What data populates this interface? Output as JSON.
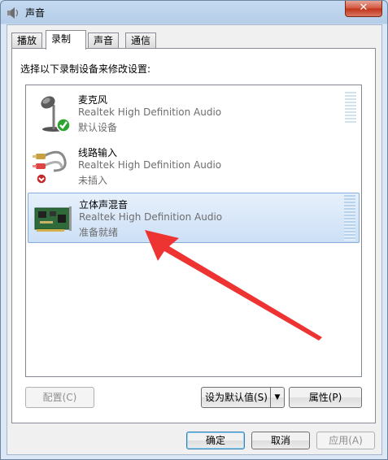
{
  "window": {
    "title": "声音",
    "close_symbol": "✕"
  },
  "tabs": [
    {
      "label": "播放"
    },
    {
      "label": "录制"
    },
    {
      "label": "声音"
    },
    {
      "label": "通信"
    }
  ],
  "instruction": "选择以下录制设备来修改设置:",
  "devices": [
    {
      "name": "麦克风",
      "driver": "Realtek High Definition Audio",
      "status": "默认设备",
      "icon": "microphone-icon"
    },
    {
      "name": "线路输入",
      "driver": "Realtek High Definition Audio",
      "status": "未插入",
      "icon": "line-in-icon"
    },
    {
      "name": "立体声混音",
      "driver": "Realtek High Definition Audio",
      "status": "准备就绪",
      "icon": "sound-card-icon"
    }
  ],
  "buttons": {
    "configure": "配置(C)",
    "set_default": "设为默认值(S)",
    "properties": "属性(P)",
    "ok": "确定",
    "cancel": "取消",
    "apply": "应用(A)"
  },
  "colors": {
    "accent": "#3399ff",
    "arrow": "#ee3333"
  }
}
